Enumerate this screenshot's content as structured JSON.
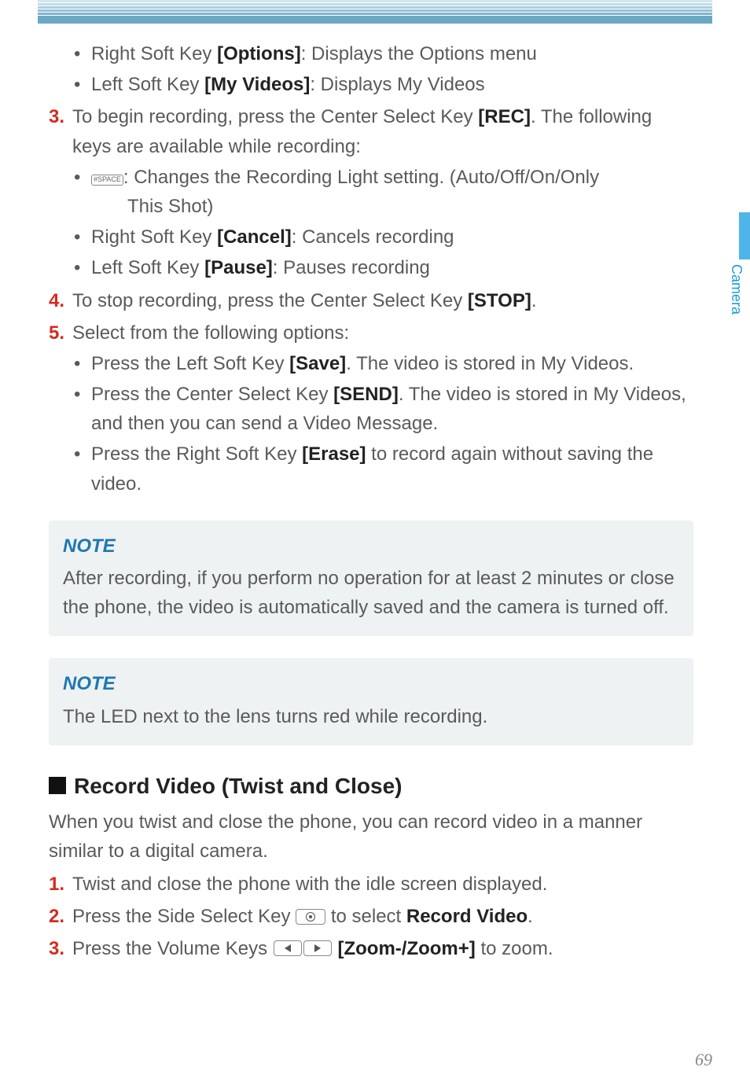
{
  "sideTab": "Camera",
  "topBullets": [
    {
      "pre": "Right Soft Key ",
      "bold": "[Options]",
      "post": ": Displays the Options menu"
    },
    {
      "pre": "Left Soft Key ",
      "bold": "[My Videos]",
      "post": ": Displays My Videos"
    }
  ],
  "step3": {
    "num": "3.",
    "text_pre": "To begin recording, press the Center Select Key ",
    "text_bold": "[REC]",
    "text_post": ". The following keys are available while recording:",
    "sub": [
      {
        "icon": "hash",
        "pre": "",
        "post": ": Changes the Recording Light setting. (Auto/Off/On/Only",
        "extra": "This Shot)"
      },
      {
        "pre": "Right Soft Key ",
        "bold": "[Cancel]",
        "post": ": Cancels recording"
      },
      {
        "pre": "Left Soft Key ",
        "bold": "[Pause]",
        "post": ": Pauses recording"
      }
    ]
  },
  "step4": {
    "num": "4.",
    "pre": "To stop recording, press the Center Select Key ",
    "bold": "[STOP]",
    "post": "."
  },
  "step5": {
    "num": "5.",
    "text": "Select from the following options:",
    "sub": [
      {
        "pre": "Press the Left Soft Key ",
        "bold": "[Save]",
        "post": ". The video is stored in My Videos."
      },
      {
        "pre": "Press the Center Select Key ",
        "bold": "[SEND]",
        "post": ". The video is stored in My Videos, and then you can send a Video Message."
      },
      {
        "pre": "Press the Right Soft Key ",
        "bold": "[Erase]",
        "post": " to record again without saving the video."
      }
    ]
  },
  "note1": {
    "title": "NOTE",
    "body": "After recording, if you perform no operation for at least 2 minutes or close the phone, the video is automatically saved and the camera is turned off."
  },
  "note2": {
    "title": "NOTE",
    "body": "The LED next to the lens turns red while recording."
  },
  "section": {
    "heading": "Record Video (Twist and Close)",
    "intro": "When you twist and close the phone, you can record video in a manner similar to a digital camera.",
    "steps": [
      {
        "num": "1.",
        "text": "Twist and close the phone with the idle screen displayed."
      },
      {
        "num": "2.",
        "pre": "Press the Side Select Key ",
        "post": " to select ",
        "bold": "Record Video",
        "post2": "."
      },
      {
        "num": "3.",
        "pre": "Press the Volume Keys ",
        "bold": "[Zoom-/Zoom+]",
        "post": " to zoom."
      }
    ]
  },
  "pageNum": "69",
  "hashKeyLabel": "#SPACE"
}
